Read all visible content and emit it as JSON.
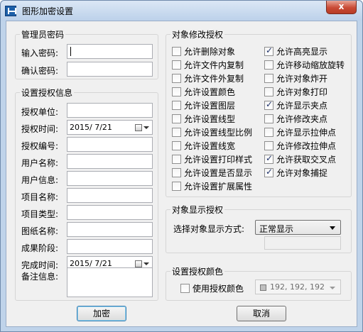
{
  "window": {
    "title": "图形加密设置",
    "close_glyph": "x"
  },
  "admin_password": {
    "group_title": "管理员密码",
    "input_label": "输入密码:",
    "confirm_label": "确认密码:",
    "input_value": "",
    "confirm_value": ""
  },
  "auth_info": {
    "group_title": "设置授权信息",
    "unit_label": "授权单位:",
    "time_label": "授权时间:",
    "time_value": "2015/ 7/21",
    "number_label": "授权编号:",
    "username_label": "用户名称:",
    "userinfo_label": "用户信息:",
    "project_name_label": "项目名称:",
    "project_type_label": "项目类型:",
    "drawing_name_label": "图纸名称:",
    "stage_label": "成果阶段:",
    "done_time_label": "完成时间:",
    "done_time_value": "2015/ 7/21",
    "remarks_label": "备注信息:"
  },
  "permissions": {
    "group_title": "对象修改授权",
    "left": [
      {
        "label": "允许删除对象",
        "checked": false
      },
      {
        "label": "允许文件内复制",
        "checked": false
      },
      {
        "label": "允许文件外复制",
        "checked": false
      },
      {
        "label": "允许设置颜色",
        "checked": false
      },
      {
        "label": "允许设置图层",
        "checked": false
      },
      {
        "label": "允许设置线型",
        "checked": false
      },
      {
        "label": "允许设置线型比例",
        "checked": false
      },
      {
        "label": "允许设置线宽",
        "checked": false
      },
      {
        "label": "允许设置打印样式",
        "checked": false
      },
      {
        "label": "允许设置是否显示",
        "checked": false
      },
      {
        "label": "允许设置扩展属性",
        "checked": false
      }
    ],
    "right": [
      {
        "label": "允许高亮显示",
        "checked": true
      },
      {
        "label": "允许移动缩放旋转",
        "checked": false
      },
      {
        "label": "允许对象炸开",
        "checked": false
      },
      {
        "label": "允许对象打印",
        "checked": false
      },
      {
        "label": "允许显示夹点",
        "checked": true
      },
      {
        "label": "允许修改夹点",
        "checked": false
      },
      {
        "label": "允许显示拉伸点",
        "checked": false
      },
      {
        "label": "允许修改拉伸点",
        "checked": false
      },
      {
        "label": "允许获取交叉点",
        "checked": true
      },
      {
        "label": "允许对象捕捉",
        "checked": true
      }
    ]
  },
  "display_auth": {
    "group_title": "对象显示授权",
    "mode_label": "选择对象显示方式:",
    "mode_value": "正常显示"
  },
  "auth_color": {
    "group_title": "设置授权颜色",
    "use_color_label": "使用授权颜色",
    "use_color_checked": false,
    "color_value": "192, 192, 192",
    "swatch_color": "#c0c0c0"
  },
  "buttons": {
    "encrypt": "加密",
    "cancel": "取消"
  }
}
